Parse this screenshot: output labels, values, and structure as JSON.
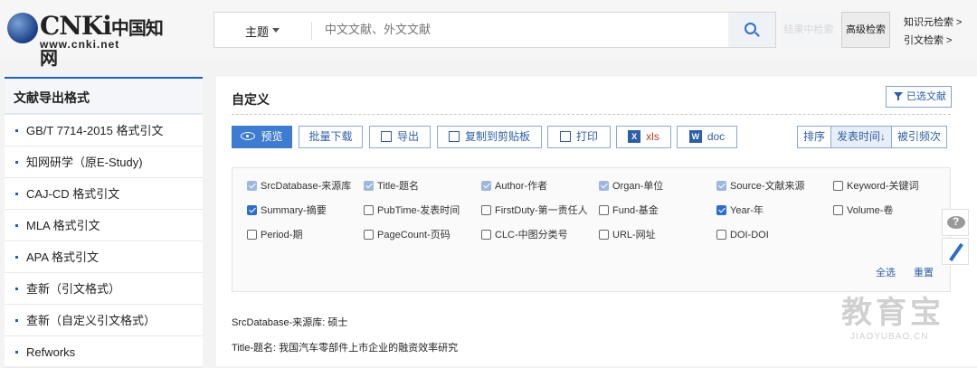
{
  "header": {
    "logo_brand": "CNKi",
    "logo_cn": "中国知网",
    "logo_url": "www.cnki.net",
    "search_field": "主题",
    "search_placeholder": "中文文献、外文文献",
    "ghost_button": "结果中检索",
    "advanced_button": "高级检索",
    "links": [
      "知识元检索 >",
      "引文检索 >"
    ]
  },
  "sidebar": {
    "title": "文献导出格式",
    "items": [
      "GB/T 7714-2015 格式引文",
      "知网研学（原E-Study)",
      "CAJ-CD 格式引文",
      "MLA 格式引文",
      "APA 格式引文",
      "查新（引文格式）",
      "查新（自定义引文格式）",
      "Refworks"
    ]
  },
  "main": {
    "title": "自定义",
    "selected_button": "已选文献",
    "toolbar": [
      "预览",
      "批量下载",
      "导出",
      "复制到剪贴板",
      "打印",
      "xls",
      "doc"
    ],
    "sort": [
      "排序",
      "发表时间↓",
      "被引频次"
    ],
    "fields": [
      {
        "label": "SrcDatabase-来源库",
        "state": "dim"
      },
      {
        "label": "Title-题名",
        "state": "dim"
      },
      {
        "label": "Author-作者",
        "state": "dim"
      },
      {
        "label": "Organ-单位",
        "state": "dim"
      },
      {
        "label": "Source-文献来源",
        "state": "dim"
      },
      {
        "label": "Keyword-关键词",
        "state": "off"
      },
      {
        "label": "Summary-摘要",
        "state": "on"
      },
      {
        "label": "PubTime-发表时间",
        "state": "off"
      },
      {
        "label": "FirstDuty-第一责任人",
        "state": "off"
      },
      {
        "label": "Fund-基金",
        "state": "off"
      },
      {
        "label": "Year-年",
        "state": "on"
      },
      {
        "label": "Volume-卷",
        "state": "off"
      },
      {
        "label": "Period-期",
        "state": "off"
      },
      {
        "label": "PageCount-页码",
        "state": "off"
      },
      {
        "label": "CLC-中图分类号",
        "state": "off"
      },
      {
        "label": "URL-网址",
        "state": "off"
      },
      {
        "label": "DOI-DOI",
        "state": "off"
      }
    ],
    "select_all": "全选",
    "reset": "重置",
    "results": [
      "SrcDatabase-来源库: 硕士",
      "Title-题名: 我国汽车零部件上市企业的融资效率研究"
    ]
  },
  "watermark": {
    "big": "教育宝",
    "small": "JIAOYUBAO.CN"
  },
  "colors": {
    "accent": "#3d7cd0",
    "link": "#2d5fa8"
  }
}
